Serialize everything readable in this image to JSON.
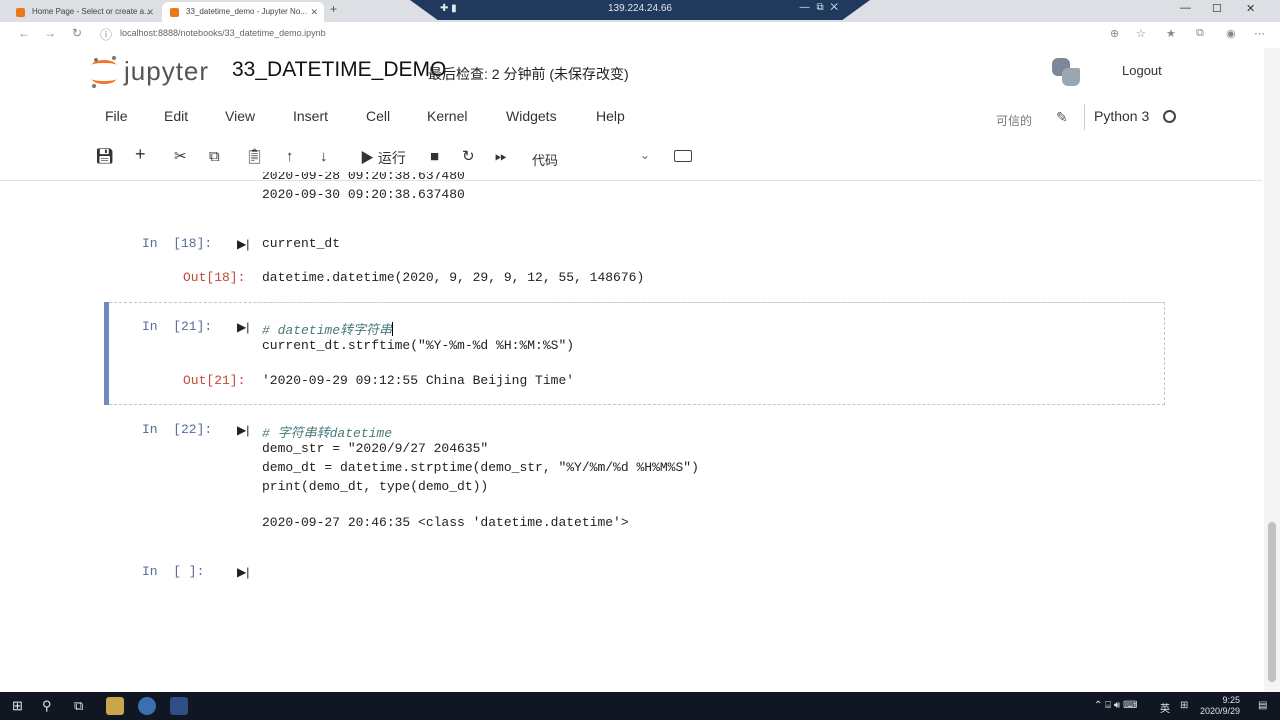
{
  "browser": {
    "tabs": [
      {
        "title": "Home Page - Select or create a..."
      },
      {
        "title": "33_datetime_demo - Jupyter No..."
      }
    ],
    "new_tab": "+",
    "remote_ip": "139.224.24.66",
    "url": "localhost:8888/notebooks/33_datetime_demo.ipynb"
  },
  "header": {
    "logo_text": "jupyter",
    "notebook_title": "33_DATETIME_DEMO",
    "checkpoint": "最后检查: 2 分钟前  (未保存改变)",
    "logout": "Logout"
  },
  "menu": {
    "items": [
      "File",
      "Edit",
      "View",
      "Insert",
      "Cell",
      "Kernel",
      "Widgets",
      "Help"
    ],
    "trusted": "可信的",
    "kernel_name": "Python 3"
  },
  "toolbar": {
    "run_label": "运行",
    "cell_type": "代码"
  },
  "cells": {
    "prev_output": {
      "line_1": "2020-09-28 09:20:38.637480",
      "line_2": "2020-09-30 09:20:38.637480"
    },
    "c18": {
      "prompt_in": "In  [18]:",
      "code": "current_dt",
      "prompt_out": "Out[18]:",
      "output": "datetime.datetime(2020, 9, 29, 9, 12, 55, 148676)"
    },
    "c21": {
      "prompt_in": "In  [21]:",
      "code_1": "# datetime转字符串",
      "code_2": "current_dt.strftime(\"%Y-%m-%d %H:%M:%S\")",
      "prompt_out": "Out[21]:",
      "output": "'2020-09-29 09:12:55 China Beijing Time'"
    },
    "c22": {
      "prompt_in": "In  [22]:",
      "code_1": "# 字符串转datetime",
      "code_2": "demo_str = \"2020/9/27 204635\"",
      "code_3": "demo_dt = datetime.strptime(demo_str, \"%Y/%m/%d %H%M%S\")",
      "code_4": "print(demo_dt, type(demo_dt))",
      "output": "2020-09-27 20:46:35 <class 'datetime.datetime'>"
    },
    "empty": {
      "prompt_in": "In  [ ]:"
    }
  },
  "taskbar": {
    "lang": "英",
    "time": "9:25",
    "date": "2020/9/29"
  }
}
